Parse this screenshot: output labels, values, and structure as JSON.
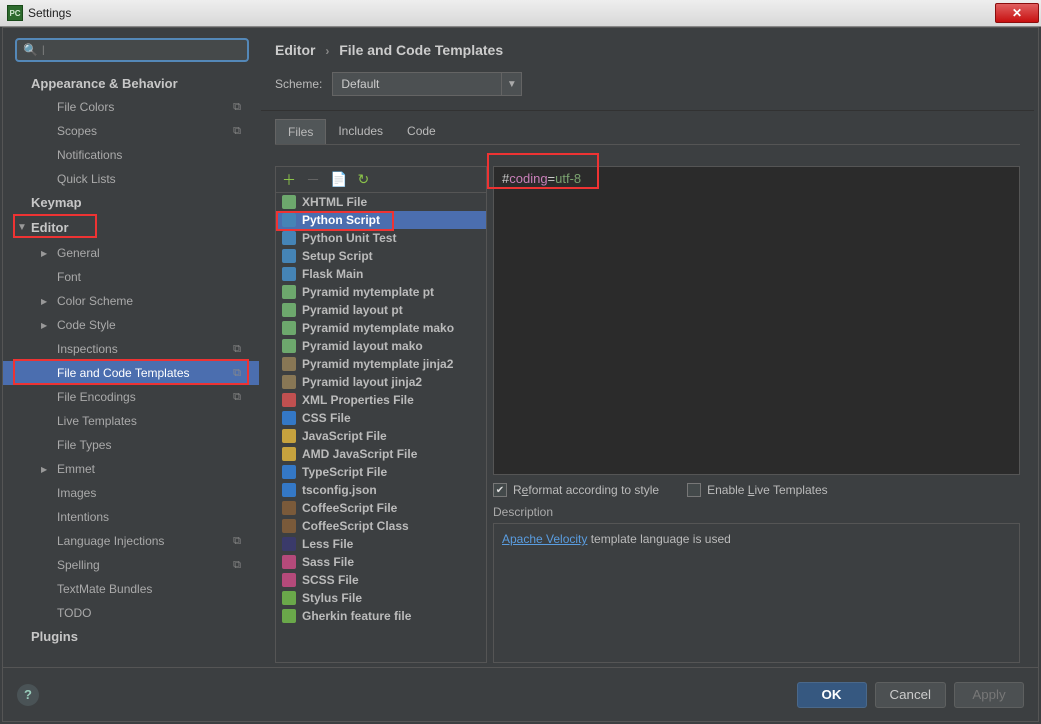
{
  "window": {
    "title": "Settings"
  },
  "breadcrumb": {
    "first": "Editor",
    "second": "File and Code Templates"
  },
  "scheme": {
    "label": "Scheme:",
    "value": "Default"
  },
  "tabs": {
    "files": "Files",
    "includes": "Includes",
    "code": "Code",
    "active": "Files"
  },
  "sidebar": {
    "appearance": "Appearance & Behavior",
    "appearance_items": [
      "File Colors",
      "Scopes",
      "Notifications",
      "Quick Lists"
    ],
    "keymap": "Keymap",
    "editor": "Editor",
    "editor_items": [
      {
        "label": "General",
        "expandable": true
      },
      {
        "label": "Font",
        "expandable": false
      },
      {
        "label": "Color Scheme",
        "expandable": true
      },
      {
        "label": "Code Style",
        "expandable": true
      },
      {
        "label": "Inspections",
        "expandable": false,
        "copy": true
      },
      {
        "label": "File and Code Templates",
        "expandable": false,
        "copy": true,
        "selected": true
      },
      {
        "label": "File Encodings",
        "expandable": false,
        "copy": true
      },
      {
        "label": "Live Templates",
        "expandable": false
      },
      {
        "label": "File Types",
        "expandable": false
      },
      {
        "label": "Emmet",
        "expandable": true
      },
      {
        "label": "Images",
        "expandable": false
      },
      {
        "label": "Intentions",
        "expandable": false
      },
      {
        "label": "Language Injections",
        "expandable": false,
        "copy": true
      },
      {
        "label": "Spelling",
        "expandable": false,
        "copy": true
      },
      {
        "label": "TextMate Bundles",
        "expandable": false
      },
      {
        "label": "TODO",
        "expandable": false
      }
    ],
    "plugins": "Plugins"
  },
  "templates": [
    {
      "label": "XHTML File",
      "color": "#6da86d"
    },
    {
      "label": "Python Script",
      "color": "#4584b6",
      "selected": true
    },
    {
      "label": "Python Unit Test",
      "color": "#4584b6"
    },
    {
      "label": "Setup Script",
      "color": "#4584b6"
    },
    {
      "label": "Flask Main",
      "color": "#4584b6"
    },
    {
      "label": "Pyramid mytemplate pt",
      "color": "#6da86d"
    },
    {
      "label": "Pyramid layout pt",
      "color": "#6da86d"
    },
    {
      "label": "Pyramid mytemplate mako",
      "color": "#6da86d"
    },
    {
      "label": "Pyramid layout mako",
      "color": "#6da86d"
    },
    {
      "label": "Pyramid mytemplate jinja2",
      "color": "#887755"
    },
    {
      "label": "Pyramid layout jinja2",
      "color": "#887755"
    },
    {
      "label": "XML Properties File",
      "color": "#c05050"
    },
    {
      "label": "CSS File",
      "color": "#3478c6"
    },
    {
      "label": "JavaScript File",
      "color": "#c6a23e"
    },
    {
      "label": "AMD JavaScript File",
      "color": "#c6a23e"
    },
    {
      "label": "TypeScript File",
      "color": "#3478c6"
    },
    {
      "label": "tsconfig.json",
      "color": "#3478c6"
    },
    {
      "label": "CoffeeScript File",
      "color": "#7a5a3a"
    },
    {
      "label": "CoffeeScript Class",
      "color": "#7a5a3a"
    },
    {
      "label": "Less File",
      "color": "#3a3a6a"
    },
    {
      "label": "Sass File",
      "color": "#b54a7a"
    },
    {
      "label": "SCSS File",
      "color": "#b54a7a"
    },
    {
      "label": "Stylus File",
      "color": "#6aa84a"
    },
    {
      "label": "Gherkin feature file",
      "color": "#6aa84a"
    }
  ],
  "code": {
    "hash": "#",
    "key": "coding",
    "eq": "=",
    "val": "utf-8"
  },
  "options": {
    "reformat_prefix": "R",
    "reformat_underline": "e",
    "reformat_suffix": "format according to style",
    "reformat_checked": true,
    "live_prefix": "Enable ",
    "live_underline": "L",
    "live_suffix": "ive Templates",
    "live_checked": false
  },
  "description": {
    "label": "Description",
    "link": "Apache Velocity",
    "rest": " template language is used"
  },
  "buttons": {
    "ok": "OK",
    "cancel": "Cancel",
    "apply": "Apply"
  }
}
